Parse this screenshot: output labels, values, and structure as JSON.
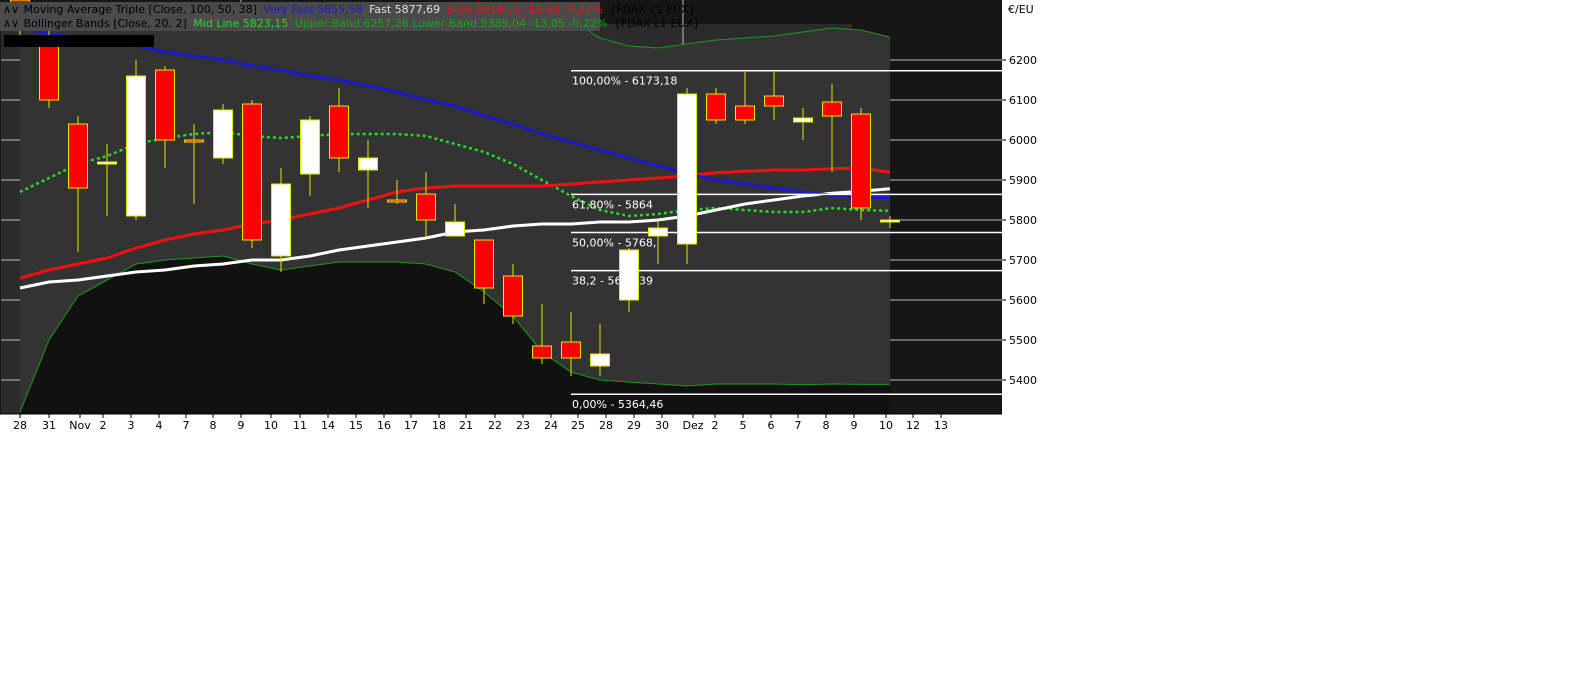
{
  "legend": {
    "line1": {
      "icon": "∧∨",
      "name": "Moving Average Triple [Close, 100, 50, 38]",
      "very_fast": "Very Fast 5855,58",
      "fast": "Fast 5877,69",
      "slow": "Slow 5918,72 -15,68 -0,27%",
      "instrument": "{FDAX c1 EUX}"
    },
    "line2": {
      "icon": "∧∨",
      "name": "Bollinger Bands [Close, 20, 2]",
      "mid": "Mid Line 5823,15",
      "upper_lower": "Upper Band 6257,26 Lower Band 5389,04 -13,05 -0,22%",
      "instrument": "{FDAX c1 EUX}"
    }
  },
  "colors": {
    "background": "#161616",
    "band_fill": "#333333",
    "band_line": "#1a9c1a",
    "mid_line": "#22dd22",
    "very_fast": "#1a1acc",
    "fast": "#ffffff",
    "slow": "#ee1111",
    "candle_up": "#ffffff",
    "candle_down": "#ff0000",
    "wick": "#e6e600",
    "grid": "#d8d8d8"
  },
  "chart_data": {
    "type": "candlestick",
    "unit": "€/EU",
    "ylim": [
      5320,
      6280
    ],
    "y_ticks": [
      5400,
      5500,
      5600,
      5700,
      5800,
      5900,
      6000,
      6100,
      6200
    ],
    "y_tick_labels": [
      "5400",
      "5500",
      "5600",
      "5700",
      "5800",
      "5900",
      "6000",
      "6100",
      "6200"
    ],
    "x_labels": [
      "28",
      "31",
      "Nov",
      "2",
      "3",
      "4",
      "7",
      "8",
      "9",
      "10",
      "11",
      "14",
      "15",
      "16",
      "17",
      "18",
      "21",
      "22",
      "23",
      "24",
      "25",
      "28",
      "29",
      "30",
      "Dez",
      "2",
      "5",
      "6",
      "7",
      "8",
      "9",
      "10",
      "12",
      "13"
    ],
    "candles": [
      {
        "open": 6350,
        "close": 6300,
        "high": 6370,
        "low": 6250
      },
      {
        "open": 6250,
        "close": 6100,
        "high": 6280,
        "low": 6080
      },
      {
        "open": 6040,
        "close": 5880,
        "high": 6060,
        "low": 5720
      },
      {
        "open": 5940,
        "close": 5945,
        "high": 5990,
        "low": 5810
      },
      {
        "open": 5810,
        "close": 6160,
        "high": 6200,
        "low": 5800
      },
      {
        "open": 6175,
        "close": 6000,
        "high": 6185,
        "low": 5930
      },
      {
        "open": 6000,
        "close": 5995,
        "high": 6040,
        "low": 5840
      },
      {
        "open": 5955,
        "close": 6075,
        "high": 6090,
        "low": 5940
      },
      {
        "open": 6090,
        "close": 5750,
        "high": 6100,
        "low": 5730
      },
      {
        "open": 5710,
        "close": 5890,
        "high": 5930,
        "low": 5670
      },
      {
        "open": 5915,
        "close": 6050,
        "high": 6060,
        "low": 5860
      },
      {
        "open": 6085,
        "close": 5955,
        "high": 6130,
        "low": 5920
      },
      {
        "open": 5925,
        "close": 5955,
        "high": 6000,
        "low": 5830
      },
      {
        "open": 5850,
        "close": 5845,
        "high": 5900,
        "low": 5840
      },
      {
        "open": 5865,
        "close": 5800,
        "high": 5920,
        "low": 5760
      },
      {
        "open": 5760,
        "close": 5795,
        "high": 5840,
        "low": 5760
      },
      {
        "open": 5750,
        "close": 5630,
        "high": 5750,
        "low": 5590
      },
      {
        "open": 5660,
        "close": 5560,
        "high": 5690,
        "low": 5540
      },
      {
        "open": 5485,
        "close": 5455,
        "high": 5590,
        "low": 5440
      },
      {
        "open": 5495,
        "close": 5455,
        "high": 5570,
        "low": 5410
      },
      {
        "open": 5435,
        "close": 5465,
        "high": 5540,
        "low": 5410
      },
      {
        "open": 5600,
        "close": 5725,
        "high": 5730,
        "low": 5570
      },
      {
        "open": 5760,
        "close": 5780,
        "high": 5800,
        "low": 5690
      },
      {
        "open": 5740,
        "close": 6115,
        "high": 6130,
        "low": 5690
      },
      {
        "open": 6115,
        "close": 6050,
        "high": 6130,
        "low": 6040
      },
      {
        "open": 6085,
        "close": 6050,
        "high": 6170,
        "low": 6040
      },
      {
        "open": 6110,
        "close": 6085,
        "high": 6170,
        "low": 6050
      },
      {
        "open": 6045,
        "close": 6055,
        "high": 6080,
        "low": 6000
      },
      {
        "open": 6095,
        "close": 6060,
        "high": 6140,
        "low": 5920
      },
      {
        "open": 6065,
        "close": 5830,
        "high": 6080,
        "low": 5800
      },
      {
        "open": 5798,
        "close": 5800,
        "high": 5810,
        "low": 5780
      }
    ],
    "series": [
      {
        "name": "Very Fast",
        "color": "#1a1acc",
        "values": [
          6280,
          6265,
          6255,
          6245,
          6235,
          6220,
          6210,
          6200,
          6185,
          6175,
          6160,
          6150,
          6135,
          6120,
          6100,
          6085,
          6060,
          6040,
          6015,
          5995,
          5975,
          5955,
          5935,
          5915,
          5900,
          5890,
          5880,
          5870,
          5862,
          5857,
          5856
        ]
      },
      {
        "name": "Fast",
        "color": "#ffffff",
        "values": [
          5630,
          5645,
          5650,
          5660,
          5670,
          5675,
          5685,
          5690,
          5700,
          5700,
          5710,
          5725,
          5735,
          5745,
          5755,
          5770,
          5775,
          5785,
          5790,
          5790,
          5795,
          5795,
          5800,
          5810,
          5825,
          5840,
          5850,
          5860,
          5867,
          5872,
          5878
        ]
      },
      {
        "name": "Slow",
        "color": "#ee1111",
        "values": [
          5655,
          5675,
          5690,
          5705,
          5730,
          5750,
          5765,
          5775,
          5790,
          5800,
          5815,
          5830,
          5850,
          5870,
          5880,
          5885,
          5885,
          5885,
          5885,
          5890,
          5895,
          5900,
          5905,
          5910,
          5918,
          5922,
          5925,
          5925,
          5928,
          5930,
          5919
        ]
      },
      {
        "name": "Mid Line",
        "color": "#22dd22",
        "values": [
          5870,
          5905,
          5940,
          5960,
          5990,
          6005,
          6015,
          6020,
          6010,
          6005,
          6010,
          6015,
          6015,
          6015,
          6010,
          5990,
          5970,
          5940,
          5900,
          5860,
          5825,
          5810,
          5815,
          5825,
          5830,
          5825,
          5820,
          5820,
          5830,
          5825,
          5823
        ]
      },
      {
        "name": "Upper Band",
        "color": "#1a9c1a",
        "values": [
          6330,
          6330,
          6330,
          6330,
          6330,
          6330,
          6330,
          6330,
          6330,
          6330,
          6330,
          6330,
          6330,
          6330,
          6330,
          6330,
          6330,
          6330,
          6330,
          6300,
          6255,
          6235,
          6230,
          6240,
          6250,
          6255,
          6260,
          6270,
          6280,
          6275,
          6257
        ]
      },
      {
        "name": "Lower Band",
        "color": "#1a9c1a",
        "values": [
          5320,
          5500,
          5610,
          5650,
          5690,
          5700,
          5705,
          5710,
          5690,
          5675,
          5685,
          5695,
          5695,
          5695,
          5690,
          5670,
          5620,
          5560,
          5470,
          5420,
          5400,
          5395,
          5390,
          5385,
          5390,
          5390,
          5390,
          5388,
          5390,
          5389,
          5389
        ]
      }
    ],
    "fibonacci": [
      {
        "label": "100,00% - 6173,18",
        "value": 6173.18
      },
      {
        "label": "61,80% - 5864",
        "value": 5864
      },
      {
        "label": "50,00% - 5768,",
        "value": 5768.82
      },
      {
        "label": "38,2 - 5673,39",
        "value": 5673.39
      },
      {
        "label": "0,00% - 5364,46",
        "value": 5364.46
      }
    ]
  }
}
